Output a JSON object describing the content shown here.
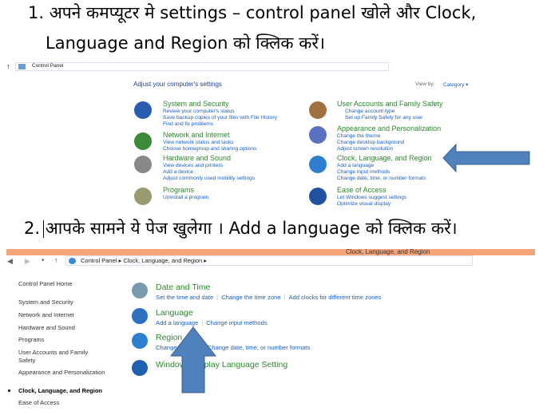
{
  "step1": {
    "line1": "1. अपने कमप्यूटर मे  settings – control panel खोले  और  Clock,",
    "line2": "Language and Region को  क्लिक  करें।"
  },
  "shot1": {
    "breadcrumb": "Control Panel",
    "title": "Adjust your computer's settings",
    "view_by_label": "View by:",
    "view_by_value": "Category",
    "categories": [
      {
        "title": "System and Security",
        "icon": "shield-icon",
        "links": [
          "Review your computer's status",
          "Save backup copies of your files with File History",
          "Find and fix problems"
        ]
      },
      {
        "title": "Network and Internet",
        "icon": "network-globe-icon",
        "links": [
          "View network status and tasks",
          "Choose homegroup and sharing options"
        ]
      },
      {
        "title": "Hardware and Sound",
        "icon": "printer-icon",
        "links": [
          "View devices and printers",
          "Add a device",
          "Adjust commonly used mobility settings"
        ]
      },
      {
        "title": "Programs",
        "icon": "programs-icon",
        "links": [
          "Uninstall a program"
        ]
      },
      {
        "title": "User Accounts and Family Safety",
        "icon": "users-icon",
        "links": [
          "Change account type",
          "Set up Family Safety for any user"
        ]
      },
      {
        "title": "Appearance and Personalization",
        "icon": "monitor-icon",
        "links": [
          "Change the theme",
          "Change desktop background",
          "Adjust screen resolution"
        ]
      },
      {
        "title": "Clock, Language, and Region",
        "icon": "clock-globe-icon",
        "links": [
          "Add a language",
          "Change input methods",
          "Change date, time, or number formats"
        ]
      },
      {
        "title": "Ease of Access",
        "icon": "ease-of-access-icon",
        "links": [
          "Let Windows suggest settings",
          "Optimize visual display"
        ]
      }
    ]
  },
  "step2": {
    "text": "2. आपके  सामने  ये  पेज  खुलेगा  ।  Add a language को  क्लिक  करें।"
  },
  "shot2": {
    "window_title": "Clock, Language, and Region",
    "breadcrumb": [
      "Control Panel",
      "Clock, Language, and Region"
    ],
    "nav": [
      "Control Panel Home",
      "System and Security",
      "Network and Internet",
      "Hardware and Sound",
      "Programs",
      "User Accounts and Family Safety",
      "Appearance and Personalization",
      "Clock, Language, and Region",
      "Ease of Access"
    ],
    "sections": [
      {
        "title": "Date and Time",
        "links": [
          "Set the time and date",
          "Change the time zone",
          "Add clocks for different time zones"
        ]
      },
      {
        "title": "Language",
        "links": [
          "Add a language",
          "Change input methods"
        ]
      },
      {
        "title": "Region",
        "links": [
          "Change location",
          "Change date, time, or number formats"
        ]
      },
      {
        "title": "Windows Display Language Setting",
        "links": []
      }
    ]
  },
  "colors": {
    "arrow": "#4f81bd",
    "title_bar": "#f4a57a",
    "category": "#2a8a2a",
    "link": "#1a5fc2"
  }
}
